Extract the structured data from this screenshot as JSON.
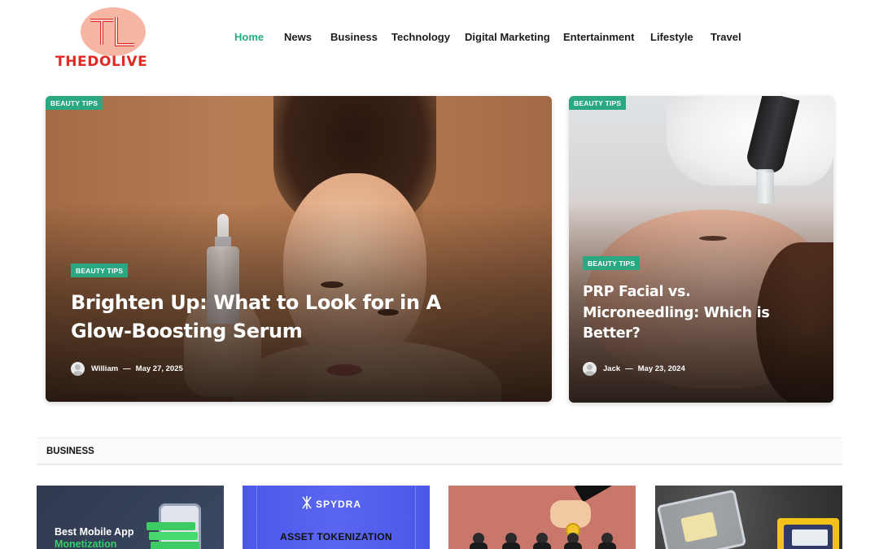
{
  "brand": {
    "name": "THEDOLIVE",
    "monogram": "TL",
    "colors": {
      "logo_red": "#e02b24",
      "logo_badge": "#f7b6a3",
      "accent_green": "#2aa882"
    }
  },
  "nav": {
    "items": [
      {
        "label": "Home",
        "active": true
      },
      {
        "label": "News",
        "active": false
      },
      {
        "label": "Business",
        "active": false
      },
      {
        "label": "Technology",
        "active": false
      },
      {
        "label": "Digital Marketing",
        "active": false
      },
      {
        "label": "Entertainment",
        "active": false
      },
      {
        "label": "Lifestyle",
        "active": false
      },
      {
        "label": "Travel",
        "active": false
      }
    ]
  },
  "featured": [
    {
      "corner_tag": "BEAUTY TIPS",
      "tag": "BEAUTY TIPS",
      "title": "Brighten Up: What to Look for in A Glow-Boosting Serum",
      "author": "William",
      "date": "May 27, 2025",
      "image_icon": "woman-holding-serum-bottle-image"
    },
    {
      "corner_tag": "BEAUTY TIPS",
      "tag": "BEAUTY TIPS",
      "title": "PRP Facial vs. Microneedling: Which is Better?",
      "author": "Jack",
      "date": "May 23, 2024",
      "image_icon": "microneedling-treatment-image"
    }
  ],
  "meta_separator": "—",
  "section": {
    "title": "BUSINESS",
    "thumbs": [
      {
        "line1": "Best Mobile App",
        "line2": "Monetization",
        "icon": "mobile-money-image"
      },
      {
        "brand": "SPYDRA",
        "subtitle": "ASSET TOKENIZATION",
        "icon": "spydra-logo-icon"
      },
      {
        "icon": "businessman-hand-coin-image"
      },
      {
        "icon": "card-reader-case-image"
      }
    ]
  }
}
